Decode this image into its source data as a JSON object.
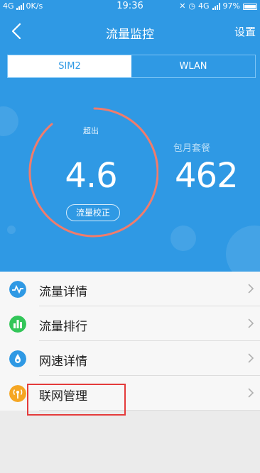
{
  "status_bar": {
    "network": "4G",
    "speed": "0K/s",
    "time": "19:36",
    "network2": "4G",
    "battery": "97%"
  },
  "nav": {
    "title": "流量监控",
    "settings_label": "设置"
  },
  "tabs": [
    {
      "label": "SIM2",
      "active": true
    },
    {
      "label": "WLAN",
      "active": false
    }
  ],
  "gauge": {
    "status": "超出",
    "value": "4.6",
    "calibrate_button": "流量校正"
  },
  "package": {
    "label": "包月套餐",
    "value": "462"
  },
  "menu": [
    {
      "label": "流量详情",
      "icon": "wave-icon",
      "color": "#2f99e4"
    },
    {
      "label": "流量排行",
      "icon": "bar-chart-icon",
      "color": "#33c659"
    },
    {
      "label": "网速详情",
      "icon": "speed-icon",
      "color": "#2f99e4"
    },
    {
      "label": "联网管理",
      "icon": "antenna-icon",
      "color": "#f5a623"
    }
  ],
  "colors": {
    "header_bg": "#2f99e4",
    "gauge_ring": "#f07c6c",
    "highlight": "#e43b3b"
  }
}
